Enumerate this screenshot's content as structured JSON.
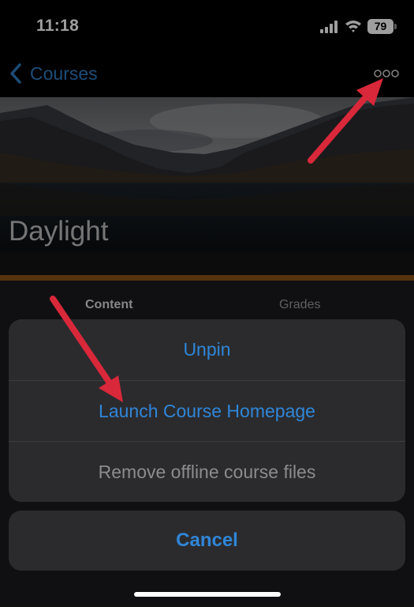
{
  "status_bar": {
    "time": "11:18",
    "battery": "79"
  },
  "nav": {
    "back_label": "Courses"
  },
  "course": {
    "title": "Daylight"
  },
  "tabs": [
    "Content",
    "Grades"
  ],
  "action_sheet": {
    "items": [
      "Unpin",
      "Launch Course Homepage",
      "Remove offline course files"
    ],
    "cancel": "Cancel"
  },
  "colors": {
    "accent_blue": "#2f86d8",
    "course_accent": "#8a5517",
    "annotation_arrow": "#d8283a"
  },
  "icons": [
    "signal-icon",
    "wifi-icon",
    "battery-icon",
    "back-chevron-icon",
    "more-dots-icon",
    "annotation-arrow-icon"
  ]
}
